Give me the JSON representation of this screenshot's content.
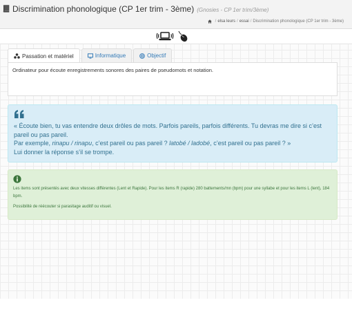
{
  "header": {
    "title": "Discrimination phonologique (CP 1er trim - 3ème)",
    "subtitle": "(Gnosies - CP 1er trim/3ème)",
    "title_icon": "book-icon"
  },
  "breadcrumb": {
    "home_icon": "home-icon",
    "items": [
      "elsa leurs",
      "essai",
      "Discrimination phonologique (CP 1er trim - 3ème)"
    ],
    "separator": "/"
  },
  "toolbar": {
    "icons": [
      "laptop-sound-icon",
      "mouse-icon"
    ]
  },
  "tabs": [
    {
      "label": "Passation et matériel",
      "icon": "materials-icon",
      "active": true
    },
    {
      "label": "Informatique",
      "icon": "monitor-icon",
      "active": false
    },
    {
      "label": "Objectif",
      "icon": "target-icon",
      "active": false
    }
  ],
  "tab_content": "Ordinateur pour écoute enregistrements sonores des paires de pseudomots et notation.",
  "quote": {
    "icon": "quote-icon",
    "line1": "« Écoute bien, tu vas entendre deux drôles de mots. Parfois pareils, parfois différents. Tu devras me dire si c’est pareil ou pas pareil.",
    "line2_prefix": "Par exemple, ",
    "example1": "rinapu / rinapu",
    "line2_middle": ", c’est pareil ou pas pareil ? ",
    "example2": "latobé / ladobé",
    "line2_suffix": ", c’est pareil ou pas pareil ? »",
    "line3": "Lui donner la réponse s’il se trompe."
  },
  "info": {
    "icon": "info-icon",
    "paragraph1": "Les items sont présentés avec deux vitesses différentes (Lent et Rapide). Pour les items R (rapide) 280 battements/mn (bpm) pour une syllabe et pour les items L (lent), 184 bpm.",
    "paragraph2": "Possibilité de réécouter si parasitage auditif ou visuel."
  },
  "colors": {
    "quote_bg": "#d9edf7",
    "quote_text": "#31708f",
    "info_bg": "#dff0d8",
    "info_text": "#3c763d",
    "link": "#337ab7"
  }
}
